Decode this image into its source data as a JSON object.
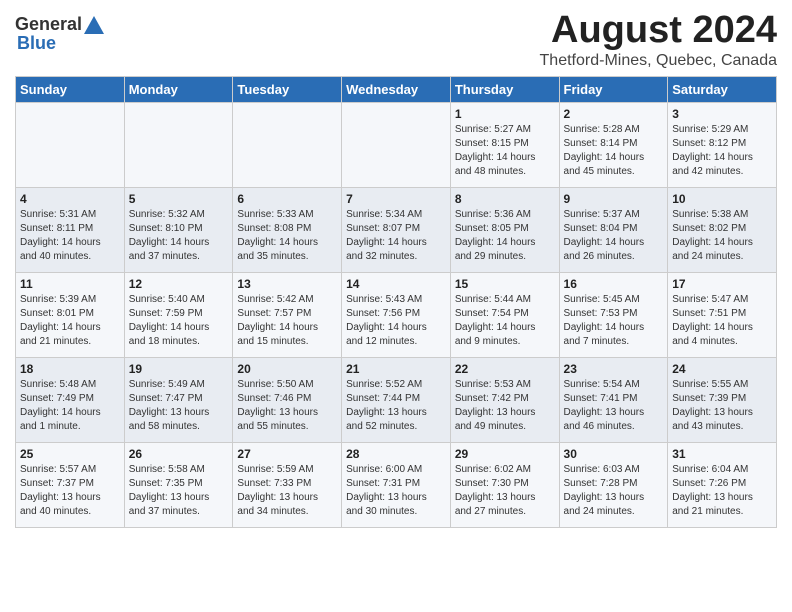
{
  "logo": {
    "general": "General",
    "blue": "Blue"
  },
  "title": "August 2024",
  "subtitle": "Thetford-Mines, Quebec, Canada",
  "days_of_week": [
    "Sunday",
    "Monday",
    "Tuesday",
    "Wednesday",
    "Thursday",
    "Friday",
    "Saturday"
  ],
  "weeks": [
    [
      {
        "day": "",
        "content": ""
      },
      {
        "day": "",
        "content": ""
      },
      {
        "day": "",
        "content": ""
      },
      {
        "day": "",
        "content": ""
      },
      {
        "day": "1",
        "content": "Sunrise: 5:27 AM\nSunset: 8:15 PM\nDaylight: 14 hours\nand 48 minutes."
      },
      {
        "day": "2",
        "content": "Sunrise: 5:28 AM\nSunset: 8:14 PM\nDaylight: 14 hours\nand 45 minutes."
      },
      {
        "day": "3",
        "content": "Sunrise: 5:29 AM\nSunset: 8:12 PM\nDaylight: 14 hours\nand 42 minutes."
      }
    ],
    [
      {
        "day": "4",
        "content": "Sunrise: 5:31 AM\nSunset: 8:11 PM\nDaylight: 14 hours\nand 40 minutes."
      },
      {
        "day": "5",
        "content": "Sunrise: 5:32 AM\nSunset: 8:10 PM\nDaylight: 14 hours\nand 37 minutes."
      },
      {
        "day": "6",
        "content": "Sunrise: 5:33 AM\nSunset: 8:08 PM\nDaylight: 14 hours\nand 35 minutes."
      },
      {
        "day": "7",
        "content": "Sunrise: 5:34 AM\nSunset: 8:07 PM\nDaylight: 14 hours\nand 32 minutes."
      },
      {
        "day": "8",
        "content": "Sunrise: 5:36 AM\nSunset: 8:05 PM\nDaylight: 14 hours\nand 29 minutes."
      },
      {
        "day": "9",
        "content": "Sunrise: 5:37 AM\nSunset: 8:04 PM\nDaylight: 14 hours\nand 26 minutes."
      },
      {
        "day": "10",
        "content": "Sunrise: 5:38 AM\nSunset: 8:02 PM\nDaylight: 14 hours\nand 24 minutes."
      }
    ],
    [
      {
        "day": "11",
        "content": "Sunrise: 5:39 AM\nSunset: 8:01 PM\nDaylight: 14 hours\nand 21 minutes."
      },
      {
        "day": "12",
        "content": "Sunrise: 5:40 AM\nSunset: 7:59 PM\nDaylight: 14 hours\nand 18 minutes."
      },
      {
        "day": "13",
        "content": "Sunrise: 5:42 AM\nSunset: 7:57 PM\nDaylight: 14 hours\nand 15 minutes."
      },
      {
        "day": "14",
        "content": "Sunrise: 5:43 AM\nSunset: 7:56 PM\nDaylight: 14 hours\nand 12 minutes."
      },
      {
        "day": "15",
        "content": "Sunrise: 5:44 AM\nSunset: 7:54 PM\nDaylight: 14 hours\nand 9 minutes."
      },
      {
        "day": "16",
        "content": "Sunrise: 5:45 AM\nSunset: 7:53 PM\nDaylight: 14 hours\nand 7 minutes."
      },
      {
        "day": "17",
        "content": "Sunrise: 5:47 AM\nSunset: 7:51 PM\nDaylight: 14 hours\nand 4 minutes."
      }
    ],
    [
      {
        "day": "18",
        "content": "Sunrise: 5:48 AM\nSunset: 7:49 PM\nDaylight: 14 hours\nand 1 minute."
      },
      {
        "day": "19",
        "content": "Sunrise: 5:49 AM\nSunset: 7:47 PM\nDaylight: 13 hours\nand 58 minutes."
      },
      {
        "day": "20",
        "content": "Sunrise: 5:50 AM\nSunset: 7:46 PM\nDaylight: 13 hours\nand 55 minutes."
      },
      {
        "day": "21",
        "content": "Sunrise: 5:52 AM\nSunset: 7:44 PM\nDaylight: 13 hours\nand 52 minutes."
      },
      {
        "day": "22",
        "content": "Sunrise: 5:53 AM\nSunset: 7:42 PM\nDaylight: 13 hours\nand 49 minutes."
      },
      {
        "day": "23",
        "content": "Sunrise: 5:54 AM\nSunset: 7:41 PM\nDaylight: 13 hours\nand 46 minutes."
      },
      {
        "day": "24",
        "content": "Sunrise: 5:55 AM\nSunset: 7:39 PM\nDaylight: 13 hours\nand 43 minutes."
      }
    ],
    [
      {
        "day": "25",
        "content": "Sunrise: 5:57 AM\nSunset: 7:37 PM\nDaylight: 13 hours\nand 40 minutes."
      },
      {
        "day": "26",
        "content": "Sunrise: 5:58 AM\nSunset: 7:35 PM\nDaylight: 13 hours\nand 37 minutes."
      },
      {
        "day": "27",
        "content": "Sunrise: 5:59 AM\nSunset: 7:33 PM\nDaylight: 13 hours\nand 34 minutes."
      },
      {
        "day": "28",
        "content": "Sunrise: 6:00 AM\nSunset: 7:31 PM\nDaylight: 13 hours\nand 30 minutes."
      },
      {
        "day": "29",
        "content": "Sunrise: 6:02 AM\nSunset: 7:30 PM\nDaylight: 13 hours\nand 27 minutes."
      },
      {
        "day": "30",
        "content": "Sunrise: 6:03 AM\nSunset: 7:28 PM\nDaylight: 13 hours\nand 24 minutes."
      },
      {
        "day": "31",
        "content": "Sunrise: 6:04 AM\nSunset: 7:26 PM\nDaylight: 13 hours\nand 21 minutes."
      }
    ]
  ]
}
